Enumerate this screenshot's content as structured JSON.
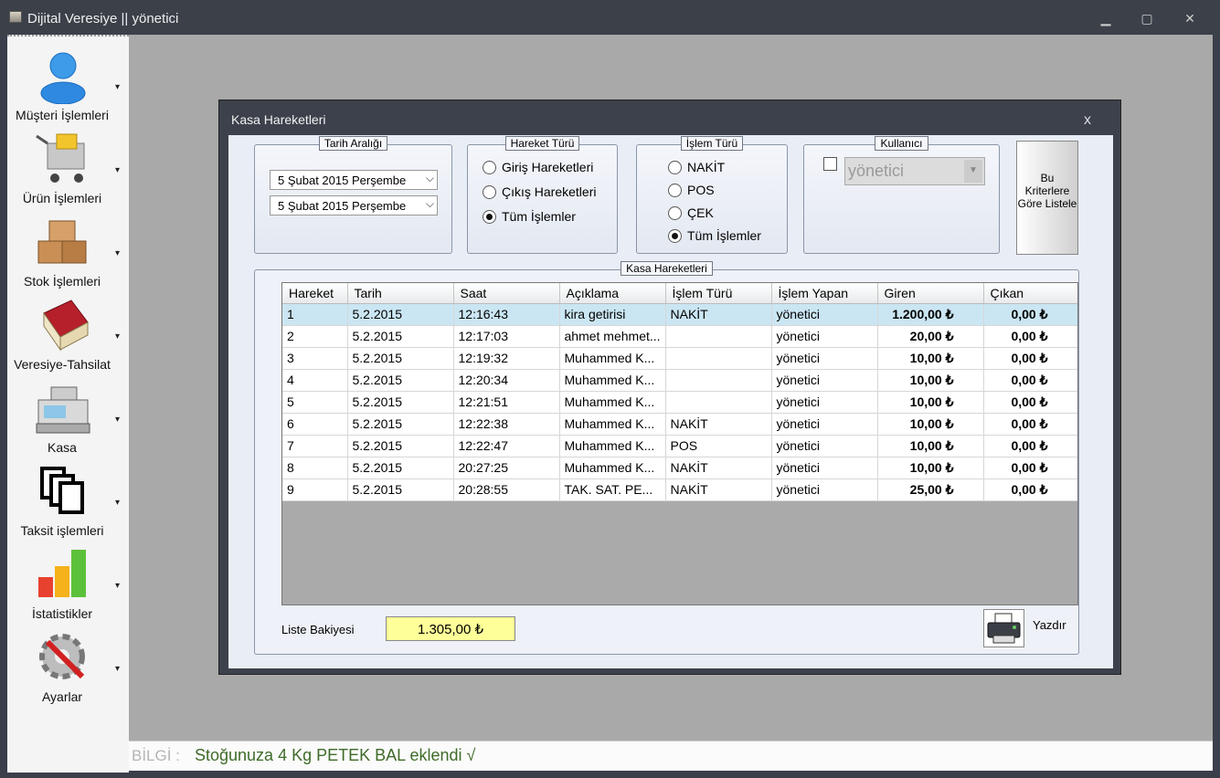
{
  "window": {
    "title": "Dijital Veresiye  ||  yönetici",
    "minimize": "▁",
    "maximize": "▢",
    "close": "✕"
  },
  "sidebar": {
    "items": [
      {
        "label": "Müşteri İşlemleri",
        "icon": "user-icon"
      },
      {
        "label": "Ürün İşlemleri",
        "icon": "cart-icon"
      },
      {
        "label": "Stok İşlemleri",
        "icon": "boxes-icon"
      },
      {
        "label": "Veresiye-Tahsilat",
        "icon": "book-icon"
      },
      {
        "label": "Kasa",
        "icon": "cash-register-icon"
      },
      {
        "label": "Taksit işlemleri",
        "icon": "copy-icon"
      },
      {
        "label": "İstatistikler",
        "icon": "bar-chart-icon"
      },
      {
        "label": "Ayarlar",
        "icon": "settings-icon"
      }
    ],
    "arrow": "▾"
  },
  "status": {
    "prefix": "BİLGİ :",
    "text": "Stoğunuza 4 Kg PETEK BAL eklendi  √"
  },
  "dialog": {
    "title": "Kasa Hareketleri",
    "close": "x",
    "date_range": {
      "legend": "Tarih Aralığı",
      "from": "5   Şubat   2015 Perşembe",
      "to": "5   Şubat   2015 Perşembe"
    },
    "movement_type": {
      "legend": "Hareket Türü",
      "options": [
        "Giriş Hareketleri",
        "Çıkış Hareketleri",
        "Tüm İşlemler"
      ],
      "selected": 2
    },
    "transaction_type": {
      "legend": "İşlem Türü",
      "options": [
        "NAKİT",
        "POS",
        "ÇEK",
        "Tüm İşlemler"
      ],
      "selected": 3
    },
    "user": {
      "legend": "Kullanıcı",
      "value": "yönetici"
    },
    "list_button": "Bu Kriterlere Göre Listele",
    "movements": {
      "legend": "Kasa Hareketleri",
      "columns": [
        "Hareket",
        "Tarih",
        "Saat",
        "Açıklama",
        "İşlem Türü",
        "İşlem Yapan",
        "Giren",
        "Çıkan"
      ],
      "rows": [
        [
          "1",
          "5.2.2015",
          "12:16:43",
          "kira getirisi",
          "NAKİT",
          "yönetici",
          "1.200,00 ₺",
          "0,00 ₺"
        ],
        [
          "2",
          "5.2.2015",
          "12:17:03",
          "ahmet mehmet...",
          "",
          "yönetici",
          "20,00 ₺",
          "0,00 ₺"
        ],
        [
          "3",
          "5.2.2015",
          "12:19:32",
          "Muhammed K...",
          "",
          "yönetici",
          "10,00 ₺",
          "0,00 ₺"
        ],
        [
          "4",
          "5.2.2015",
          "12:20:34",
          "Muhammed K...",
          "",
          "yönetici",
          "10,00 ₺",
          "0,00 ₺"
        ],
        [
          "5",
          "5.2.2015",
          "12:21:51",
          "Muhammed K...",
          "",
          "yönetici",
          "10,00 ₺",
          "0,00 ₺"
        ],
        [
          "6",
          "5.2.2015",
          "12:22:38",
          "Muhammed K...",
          "NAKİT",
          "yönetici",
          "10,00 ₺",
          "0,00 ₺"
        ],
        [
          "7",
          "5.2.2015",
          "12:22:47",
          "Muhammed K...",
          "POS",
          "yönetici",
          "10,00 ₺",
          "0,00 ₺"
        ],
        [
          "8",
          "5.2.2015",
          "20:27:25",
          "Muhammed K...",
          "NAKİT",
          "yönetici",
          "10,00 ₺",
          "0,00 ₺"
        ],
        [
          "9",
          "5.2.2015",
          "20:28:55",
          "TAK. SAT. PE...",
          "NAKİT",
          "yönetici",
          "25,00 ₺",
          "0,00 ₺"
        ]
      ],
      "selected_row": 0,
      "balance_label": "Liste Bakiyesi",
      "balance": "1.305,00 ₺",
      "print": "Yazdır"
    }
  }
}
